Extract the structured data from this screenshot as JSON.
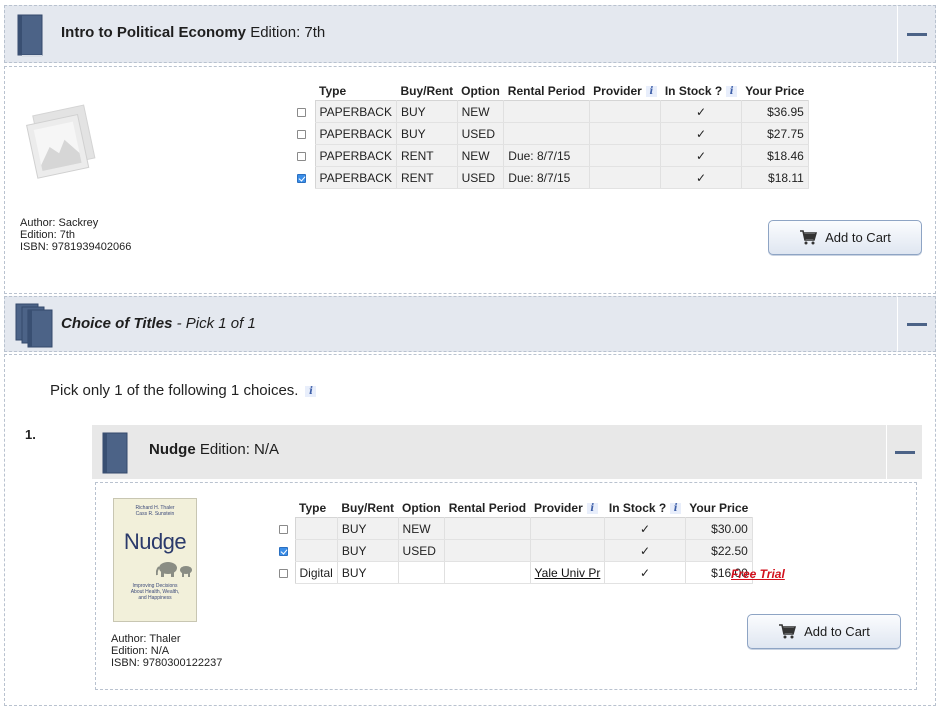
{
  "book1": {
    "title": "Intro to Political Economy",
    "edition_label": "Edition: 7th",
    "table": {
      "headers": [
        "Type",
        "Buy/Rent",
        "Option",
        "Rental Period",
        "Provider",
        "In Stock ?",
        "Your Price"
      ],
      "rows": [
        {
          "type": "PAPERBACK",
          "buy_rent": "BUY",
          "option": "NEW",
          "rental": "",
          "provider": "",
          "stock": "✓",
          "price": "$36.95",
          "checked": false
        },
        {
          "type": "PAPERBACK",
          "buy_rent": "BUY",
          "option": "USED",
          "rental": "",
          "provider": "",
          "stock": "✓",
          "price": "$27.75",
          "checked": false
        },
        {
          "type": "PAPERBACK",
          "buy_rent": "RENT",
          "option": "NEW",
          "rental": "Due: 8/7/15",
          "provider": "",
          "stock": "✓",
          "price": "$18.46",
          "checked": false
        },
        {
          "type": "PAPERBACK",
          "buy_rent": "RENT",
          "option": "USED",
          "rental": "Due: 8/7/15",
          "provider": "",
          "stock": "✓",
          "price": "$18.11",
          "checked": true
        }
      ]
    },
    "author": "Author: Sackrey",
    "edition": "Edition: 7th",
    "isbn": "ISBN: 9781939402066",
    "add_to_cart": "Add to Cart"
  },
  "choice": {
    "title": "Choice of Titles",
    "subtitle": "- Pick 1 of 1",
    "instruction": "Pick only 1 of the following 1 choices.",
    "number": "1."
  },
  "book2": {
    "title": "Nudge",
    "edition_label": "Edition: N/A",
    "cover": {
      "authors_line1": "Richard H. Thaler",
      "authors_line2": "Cass R. Sunstein",
      "title": "Nudge",
      "subtitle_line1": "Improving Decisions",
      "subtitle_line2": "About Health, Wealth,",
      "subtitle_line3": "and Happiness"
    },
    "table": {
      "headers": [
        "Type",
        "Buy/Rent",
        "Option",
        "Rental Period",
        "Provider",
        "In Stock ?",
        "Your Price"
      ],
      "rows": [
        {
          "type": "",
          "buy_rent": "BUY",
          "option": "NEW",
          "rental": "",
          "provider": "",
          "stock": "✓",
          "price": "$30.00",
          "checked": false
        },
        {
          "type": "",
          "buy_rent": "BUY",
          "option": "USED",
          "rental": "",
          "provider": "",
          "stock": "✓",
          "price": "$22.50",
          "checked": true
        },
        {
          "type": "Digital",
          "buy_rent": "BUY",
          "option": "",
          "rental": "",
          "provider": "Yale Univ Pr",
          "stock": "✓",
          "price": "$16.00",
          "checked": false
        }
      ]
    },
    "free_trial": "Free Trial",
    "author": "Author: Thaler",
    "edition": "Edition: N/A",
    "isbn": "ISBN: 9780300122237",
    "add_to_cart": "Add to Cart"
  },
  "colors": {
    "header_bg": "#e4e8ef",
    "accent": "#4c6387",
    "free_trial": "#d2101c"
  }
}
